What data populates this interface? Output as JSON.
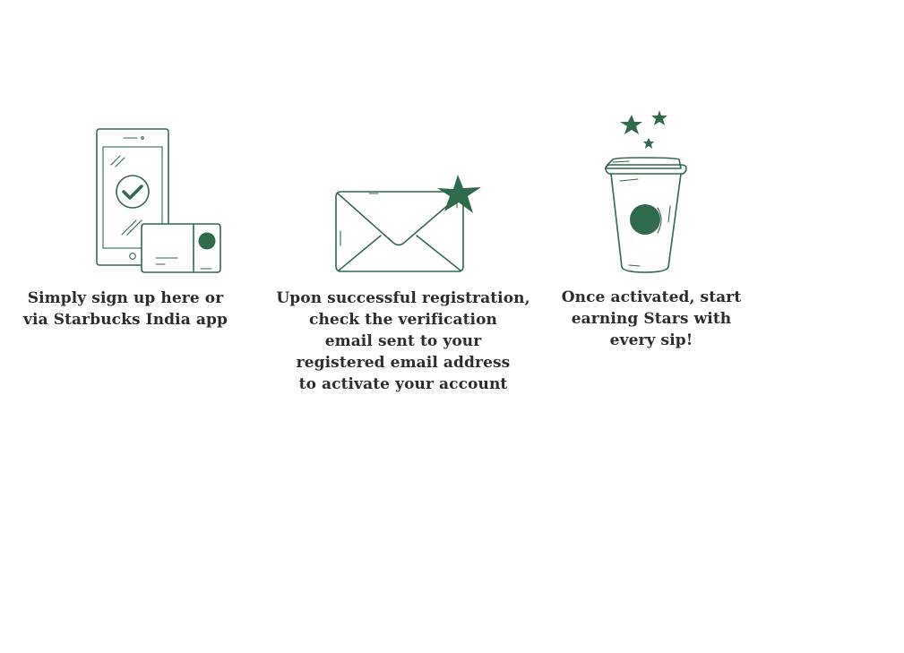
{
  "steps": [
    {
      "id": "sign-up",
      "icon": "phone-and-card-icon",
      "lines": [
        "Simply sign up here or",
        "via Starbucks India app"
      ]
    },
    {
      "id": "verify-email",
      "icon": "envelope-star-icon",
      "lines": [
        "Upon successful registration,",
        "check the verification",
        "email sent to your",
        "registered email address",
        "to activate your account"
      ]
    },
    {
      "id": "earn-stars",
      "icon": "coffee-cup-stars-icon",
      "lines": [
        "Once activated, start",
        "earning Stars with",
        "every sip!"
      ]
    }
  ],
  "colors": {
    "brand_green": "#2f6b4a",
    "text": "#2d2d2d",
    "background": "#ffffff"
  }
}
